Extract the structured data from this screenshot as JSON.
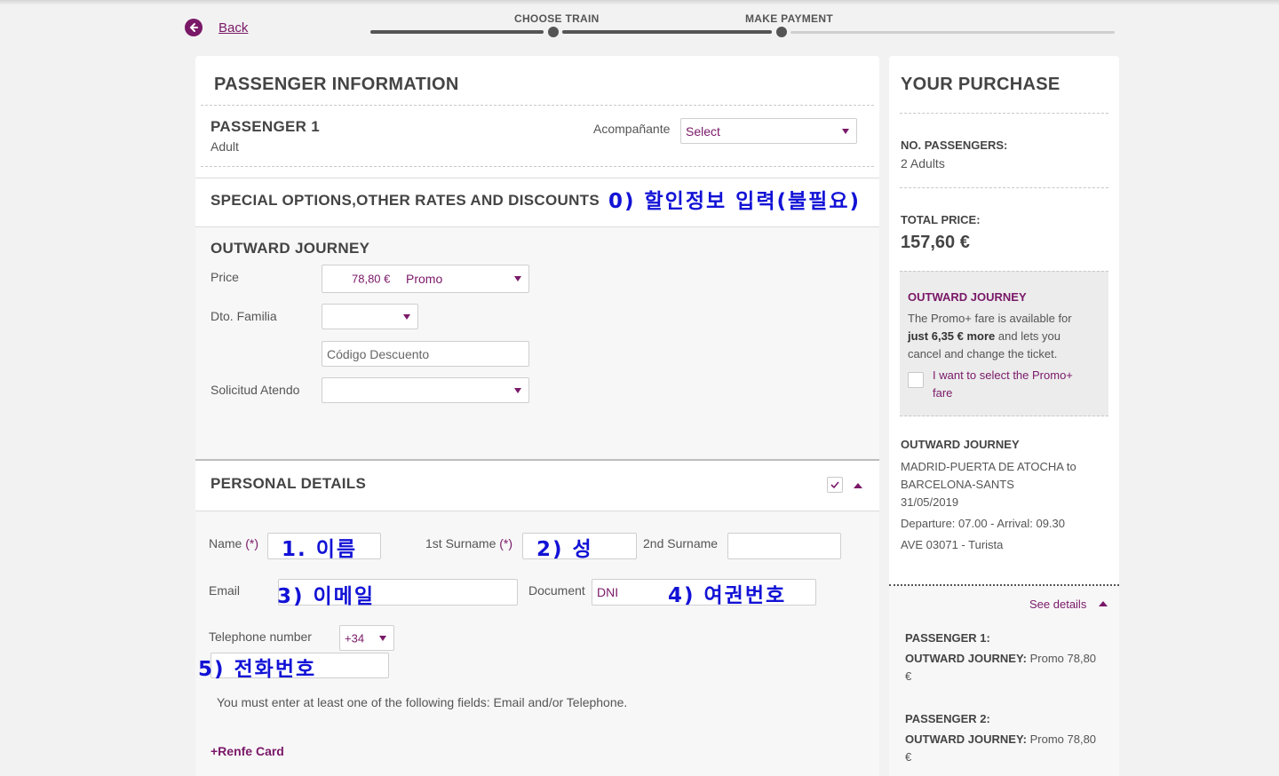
{
  "nav": {
    "back_label": "Back"
  },
  "progress": {
    "steps": [
      {
        "label": "CHOOSE TRAIN"
      },
      {
        "label": "MAKE PAYMENT"
      }
    ]
  },
  "passenger_info": {
    "title": "PASSENGER INFORMATION",
    "passenger_name": "PASSENGER 1",
    "passenger_type": "Adult",
    "companion_label": "Acompañante",
    "companion_value": "Select"
  },
  "special_options": {
    "title": "SPECIAL OPTIONS,OTHER RATES AND DISCOUNTS",
    "annotation": "0) 할인정보 입력(불필요)"
  },
  "outward": {
    "title": "OUTWARD JOURNEY",
    "price_label": "Price",
    "price_amount": "78,80 €",
    "price_fare": "Promo",
    "familia_label": "Dto. Familia",
    "familia_value": "",
    "discount_placeholder": "Código Descuento",
    "atendo_label": "Solicitud Atendo",
    "atendo_value": ""
  },
  "personal": {
    "title": "PERSONAL DETAILS",
    "name_label": "Name",
    "name_req": "(*)",
    "surname1_label": "1st Surname",
    "surname1_req": "(*)",
    "surname2_label": "2nd Surname",
    "email_label": "Email",
    "document_label": "Document",
    "document_value": "DNI",
    "phone_label": "Telephone number",
    "phone_prefix": "+34",
    "notice": "You must enter at least one of the following fields: Email and/or Telephone.",
    "renfe_card": "+Renfe Card"
  },
  "annotations": {
    "name": "1. 이름",
    "surname": "2) 성",
    "email": "3) 이메일",
    "document": "4) 여권번호",
    "phone": "5) 전화번호"
  },
  "purchase": {
    "title": "YOUR PURCHASE",
    "passengers_label": "NO. PASSENGERS:",
    "passengers_value": "2 Adults",
    "total_label": "TOTAL PRICE:",
    "total_value": "157,60 €",
    "promo_box": {
      "title": "OUTWARD JOURNEY",
      "line1": "The Promo+ fare is available for",
      "line2_bold": "just 6,35 € more",
      "line2_rest": " and lets you",
      "line3": "cancel and change the ticket.",
      "check_line1": "I want to select the Promo+",
      "check_line2": "fare"
    },
    "journey_title": "OUTWARD JOURNEY",
    "route_line1": "MADRID-PUERTA DE ATOCHA to",
    "route_line2": "BARCELONA-SANTS",
    "date": "31/05/2019",
    "times": "Departure: 07.00 - Arrival: 09.30",
    "train": "AVE 03071 - Turista",
    "see_details": "See details",
    "passenger1_label": "PASSENGER 1:",
    "passenger1_journey_label": "OUTWARD JOURNEY:",
    "passenger1_fare": " Promo 78,80",
    "passenger1_currency": "€",
    "passenger2_label": "PASSENGER 2:",
    "passenger2_journey_label": "OUTWARD JOURNEY:",
    "passenger2_fare": " Promo 78,80",
    "passenger2_currency": "€"
  },
  "colors": {
    "accent": "#7a1868",
    "annotation": "#1212d6"
  }
}
